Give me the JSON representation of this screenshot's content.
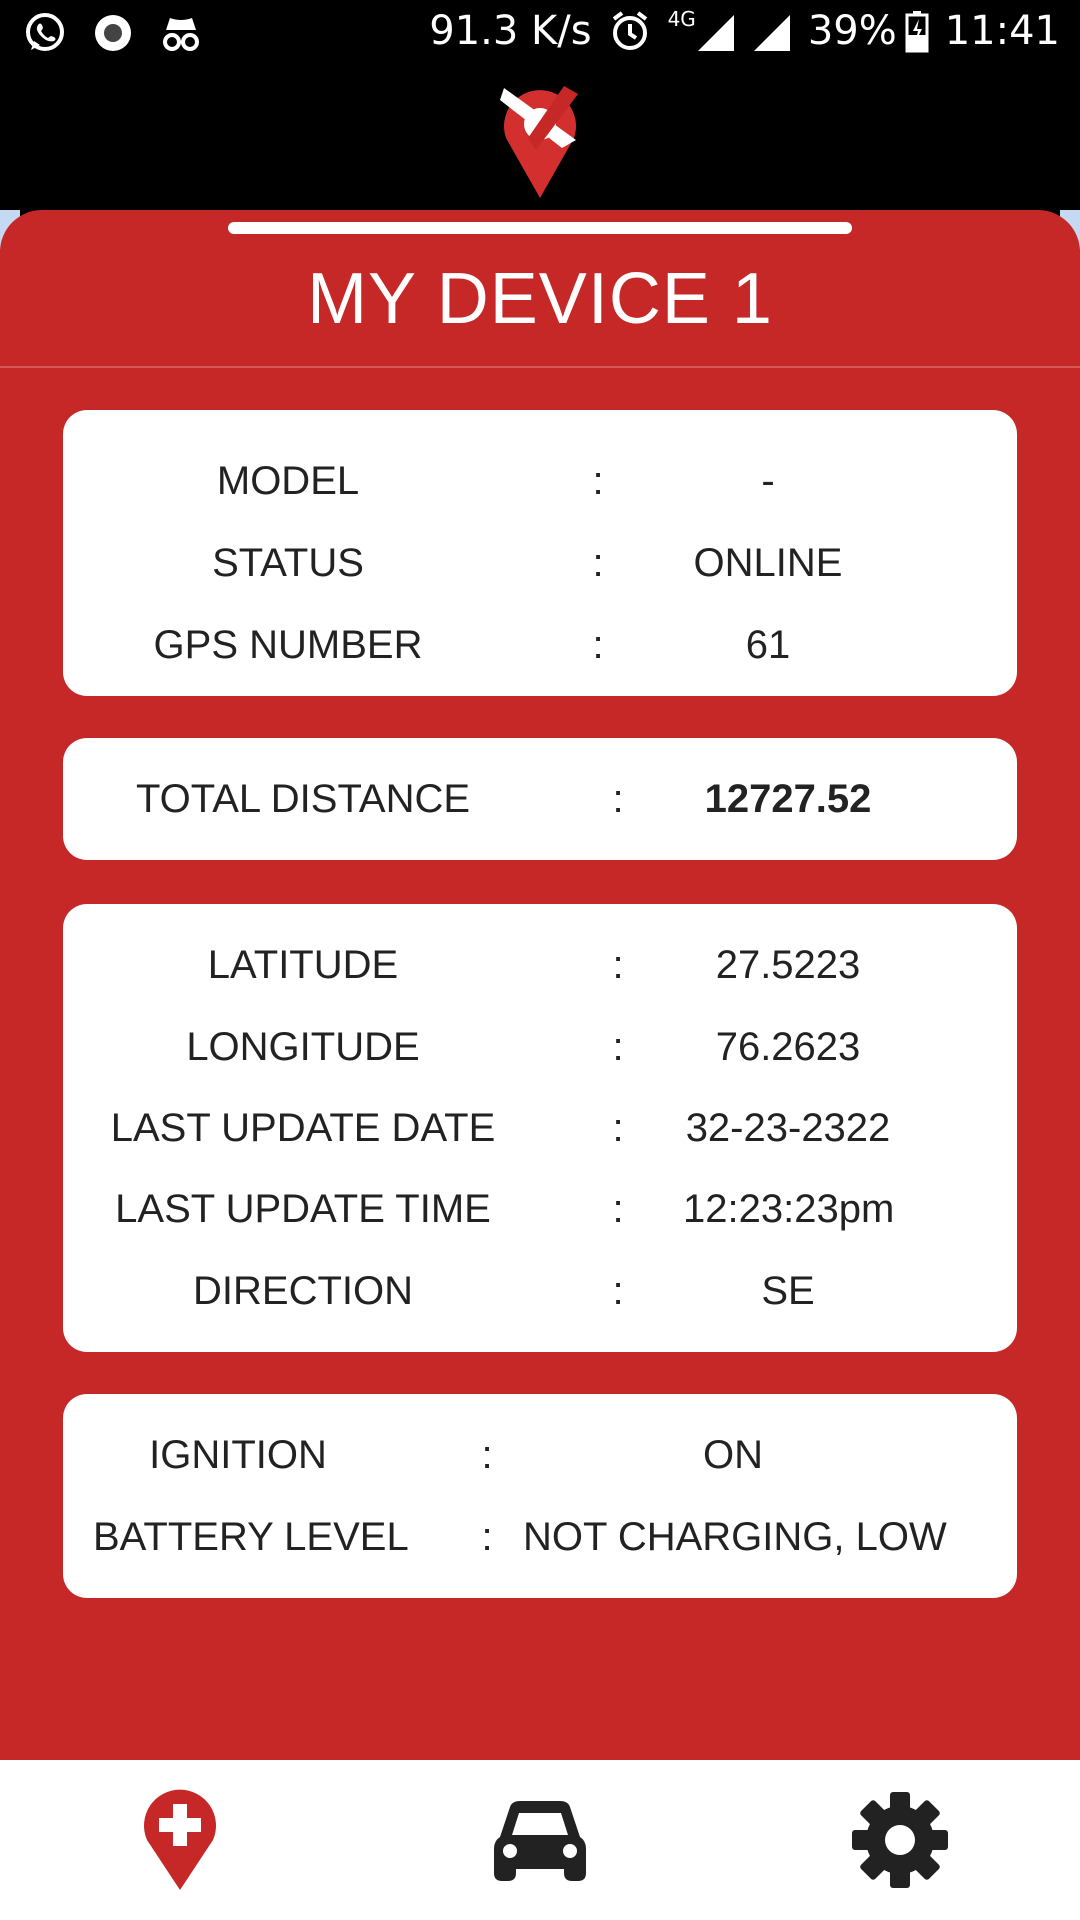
{
  "statusbar": {
    "speed": "91.3 K/s",
    "network": "4G",
    "battery": "39%",
    "time": "11:41"
  },
  "header": {
    "logo": "app-logo-pin"
  },
  "device": {
    "title": "MY DEVICE 1"
  },
  "card1": {
    "rows": [
      {
        "label": "MODEL",
        "sep": ":",
        "value": "-"
      },
      {
        "label": "STATUS",
        "sep": ":",
        "value": "ONLINE"
      },
      {
        "label": "GPS NUMBER",
        "sep": ":",
        "value": "61"
      }
    ]
  },
  "card2": {
    "rows": [
      {
        "label": "TOTAL DISTANCE",
        "sep": ":",
        "value": "12727.52"
      }
    ]
  },
  "card3": {
    "rows": [
      {
        "label": "LATITUDE",
        "sep": ":",
        "value": "27.5223"
      },
      {
        "label": "LONGITUDE",
        "sep": ":",
        "value": "76.2623"
      },
      {
        "label": "LAST UPDATE DATE",
        "sep": ":",
        "value": "32-23-2322"
      },
      {
        "label": "LAST UPDATE TIME",
        "sep": ":",
        "value": "12:23:23pm"
      },
      {
        "label": "DIRECTION",
        "sep": ":",
        "value": "SE"
      }
    ]
  },
  "card4": {
    "rows": [
      {
        "label": "IGNITION",
        "sep": ":",
        "value": "ON"
      },
      {
        "label": "BATTERY LEVEL",
        "sep": ":",
        "value": "NOT CHARGING, LOW"
      }
    ]
  },
  "nav": {
    "items": [
      {
        "icon": "location-add-icon"
      },
      {
        "icon": "car-icon"
      },
      {
        "icon": "settings-gear-icon"
      }
    ]
  },
  "colors": {
    "accent": "#c62828",
    "card": "#ffffff",
    "text": "#222222"
  }
}
